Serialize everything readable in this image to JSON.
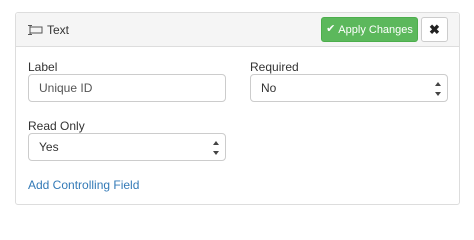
{
  "header": {
    "title": "Text",
    "apply_label": "Apply Changes",
    "close_label": "✖"
  },
  "form": {
    "label": {
      "label": "Label",
      "value": "Unique ID"
    },
    "required": {
      "label": "Required",
      "value": "No"
    },
    "read_only": {
      "label": "Read Only",
      "value": "Yes"
    }
  },
  "links": {
    "add_controlling_field": "Add Controlling Field"
  },
  "colors": {
    "apply_button": "#5cb85c",
    "link": "#337ab7"
  },
  "icons": {
    "title_icon": "text-field-icon",
    "apply_icon": "check-icon",
    "close_icon": "close-icon"
  }
}
